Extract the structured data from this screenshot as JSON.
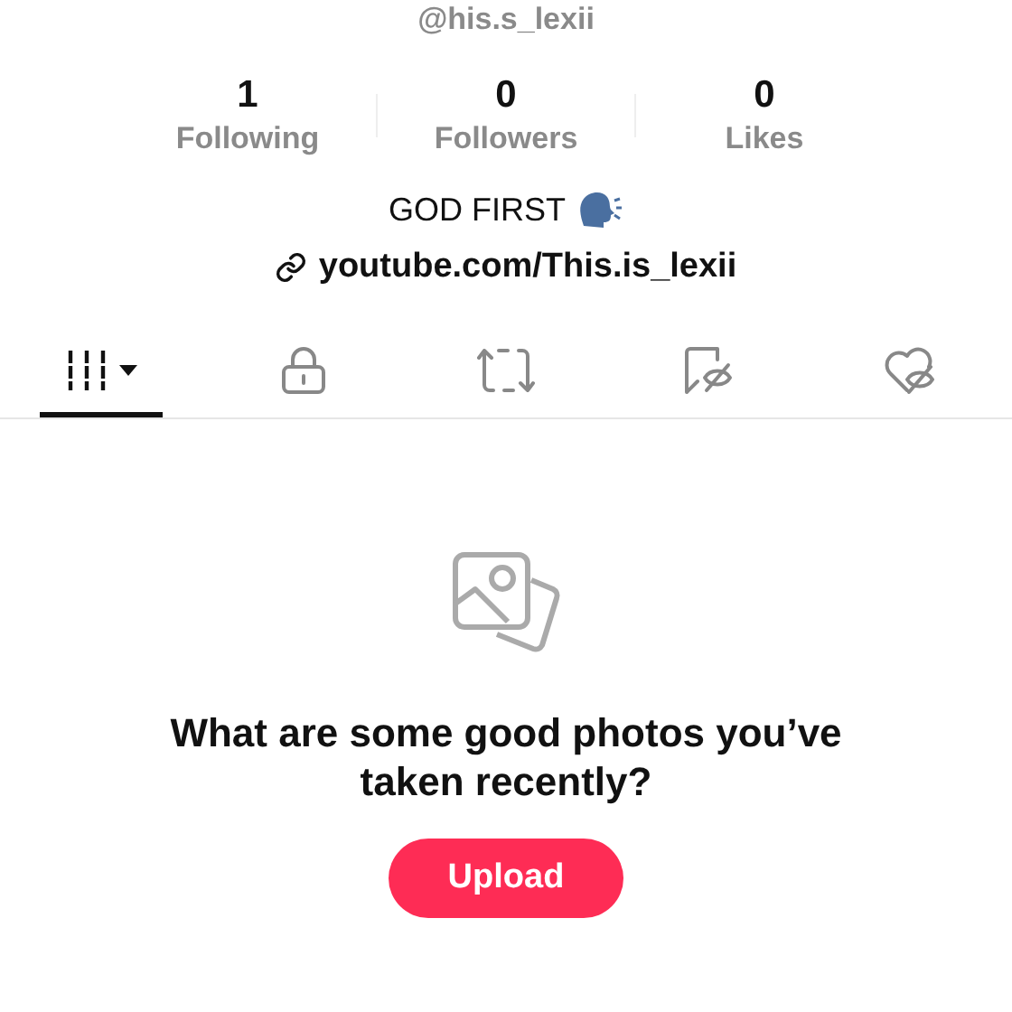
{
  "username": "@his.s_lexii",
  "stats": [
    {
      "value": "1",
      "label": "Following"
    },
    {
      "value": "0",
      "label": "Followers"
    },
    {
      "value": "0",
      "label": "Likes"
    }
  ],
  "bio": "GOD FIRST",
  "link": "youtube.com/This.is_lexii",
  "tabs": [
    {
      "kind": "videos",
      "selected": true
    },
    {
      "kind": "private",
      "selected": false
    },
    {
      "kind": "reposts",
      "selected": false
    },
    {
      "kind": "saved",
      "selected": false
    },
    {
      "kind": "liked",
      "selected": false
    }
  ],
  "empty_state": {
    "heading": "What are some good photos you’ve taken recently?",
    "button": "Upload"
  }
}
